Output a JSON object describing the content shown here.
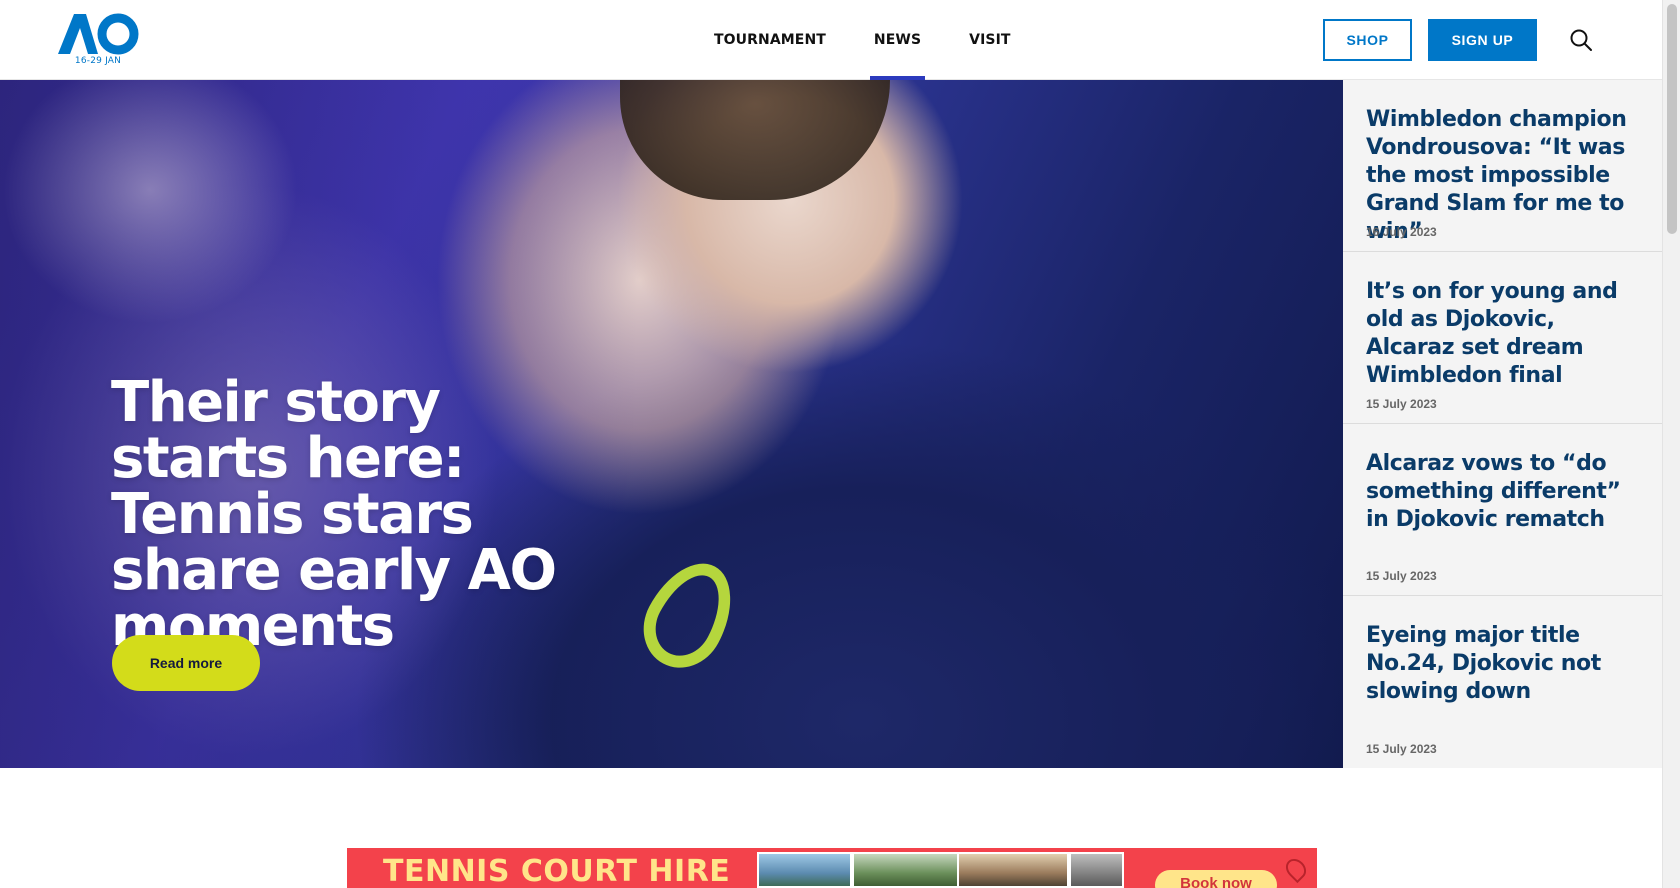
{
  "header": {
    "logo_text": "AO",
    "logo_date": "16-29 JAN",
    "nav": [
      {
        "label": "TOURNAMENT",
        "active": false
      },
      {
        "label": "NEWS",
        "active": true
      },
      {
        "label": "VISIT",
        "active": false
      }
    ],
    "shop_label": "SHOP",
    "signup_label": "SIGN UP",
    "search_icon": "search-icon"
  },
  "hero": {
    "title": "Their story starts here: Tennis stars share early AO moments",
    "button_label": "Read more"
  },
  "news": [
    {
      "title": "Wimbledon champion Vondrousova: “It was the most impossible Grand Slam for me to win”",
      "date": "16 July 2023"
    },
    {
      "title": "It’s on for young and old as Djokovic, Alcaraz set dream Wimbledon final",
      "date": "15 July 2023"
    },
    {
      "title": "Alcaraz vows to “do something different” in Djokovic rematch",
      "date": "15 July 2023"
    },
    {
      "title": "Eyeing major title No.24, Djokovic not slowing down",
      "date": "15 July 2023"
    }
  ],
  "banner": {
    "text": "TENNIS COURT HIRE",
    "button_label": "Book now"
  },
  "colors": {
    "brand_blue": "#0077c8",
    "nav_active": "#2c3abd",
    "cta_yellow": "#d3dc1a",
    "news_title": "#0a3b68",
    "banner_red": "#f3424b"
  }
}
